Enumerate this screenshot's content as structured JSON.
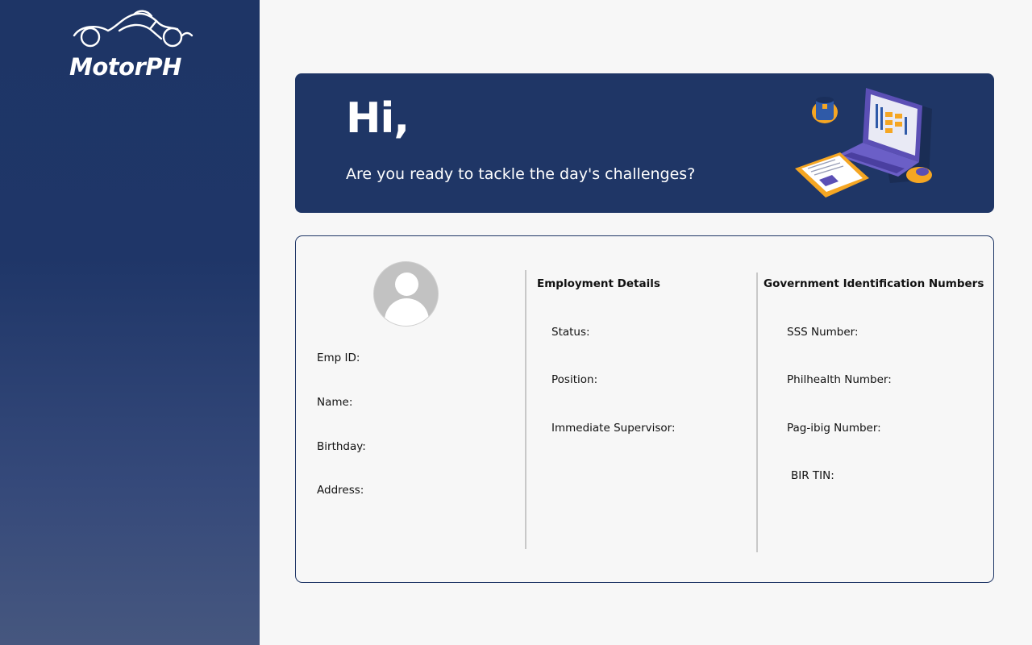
{
  "brand": {
    "name": "MotorPH"
  },
  "banner": {
    "greeting": "Hi,",
    "tagline": "Are you ready to tackle the day's challenges?"
  },
  "profile": {
    "fields": [
      {
        "label": "Emp ID:"
      },
      {
        "label": "Name:"
      },
      {
        "label": "Birthday:"
      },
      {
        "label": "Address:"
      }
    ]
  },
  "employment": {
    "heading": "Employment Details",
    "fields": [
      {
        "label": "Status:"
      },
      {
        "label": "Position:"
      },
      {
        "label": "Immediate Supervisor:"
      }
    ]
  },
  "government": {
    "heading": "Government Identification Numbers",
    "fields": [
      {
        "label": "SSS Number:"
      },
      {
        "label": "Philhealth Number:"
      },
      {
        "label": "Pag-ibig Number:"
      },
      {
        "label": "BIR TIN:"
      }
    ]
  },
  "colors": {
    "navy": "#1f3666",
    "accent_orange": "#f5a623",
    "accent_purple": "#5b4fb5"
  }
}
